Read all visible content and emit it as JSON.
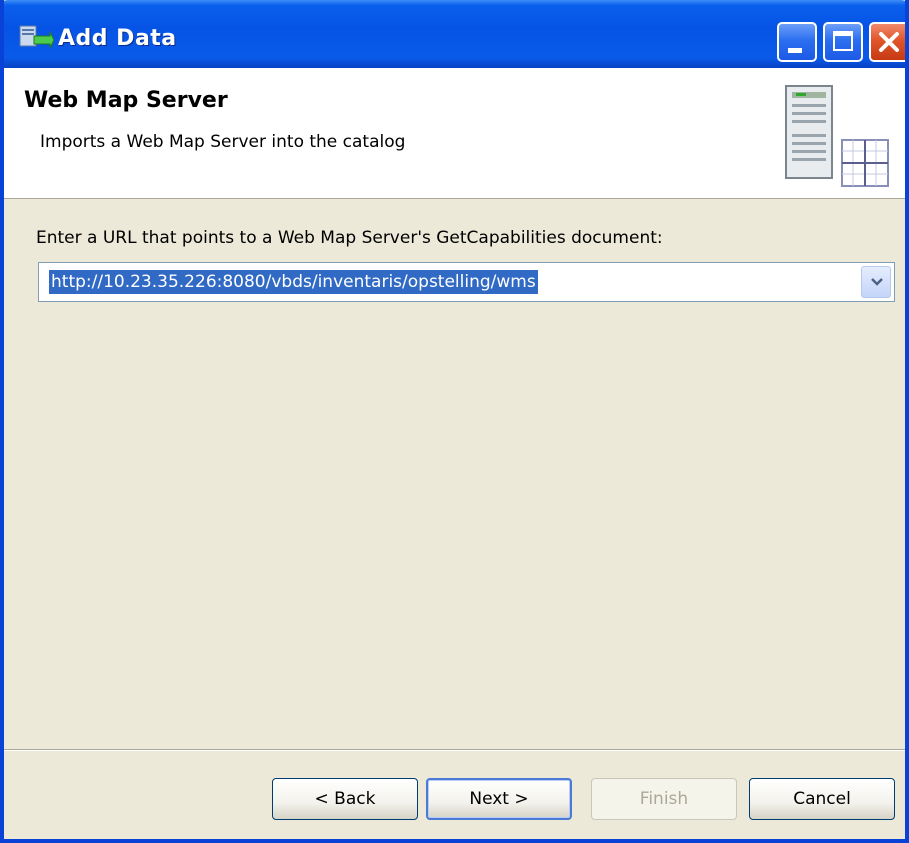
{
  "window": {
    "title": "Add Data"
  },
  "banner": {
    "title": "Web Map Server",
    "description": "Imports a Web Map Server into the catalog"
  },
  "form": {
    "prompt": "Enter a URL that points to a Web Map Server's GetCapabilities document:",
    "url_value": "http://10.23.35.226:8080/vbds/inventaris/opstelling/wms"
  },
  "buttons": {
    "back": "< Back",
    "next": "Next >",
    "finish": "Finish",
    "cancel": "Cancel"
  },
  "icons": {
    "title": "add-data-icon",
    "banner": "wms-server-icon",
    "minimize": "minimize-icon",
    "maximize": "maximize-icon",
    "close": "close-icon",
    "dropdown": "chevron-down-icon"
  },
  "colors": {
    "titlebar": "#0654e6",
    "selection": "#316ac5",
    "dialog_bg": "#ece9d8"
  }
}
